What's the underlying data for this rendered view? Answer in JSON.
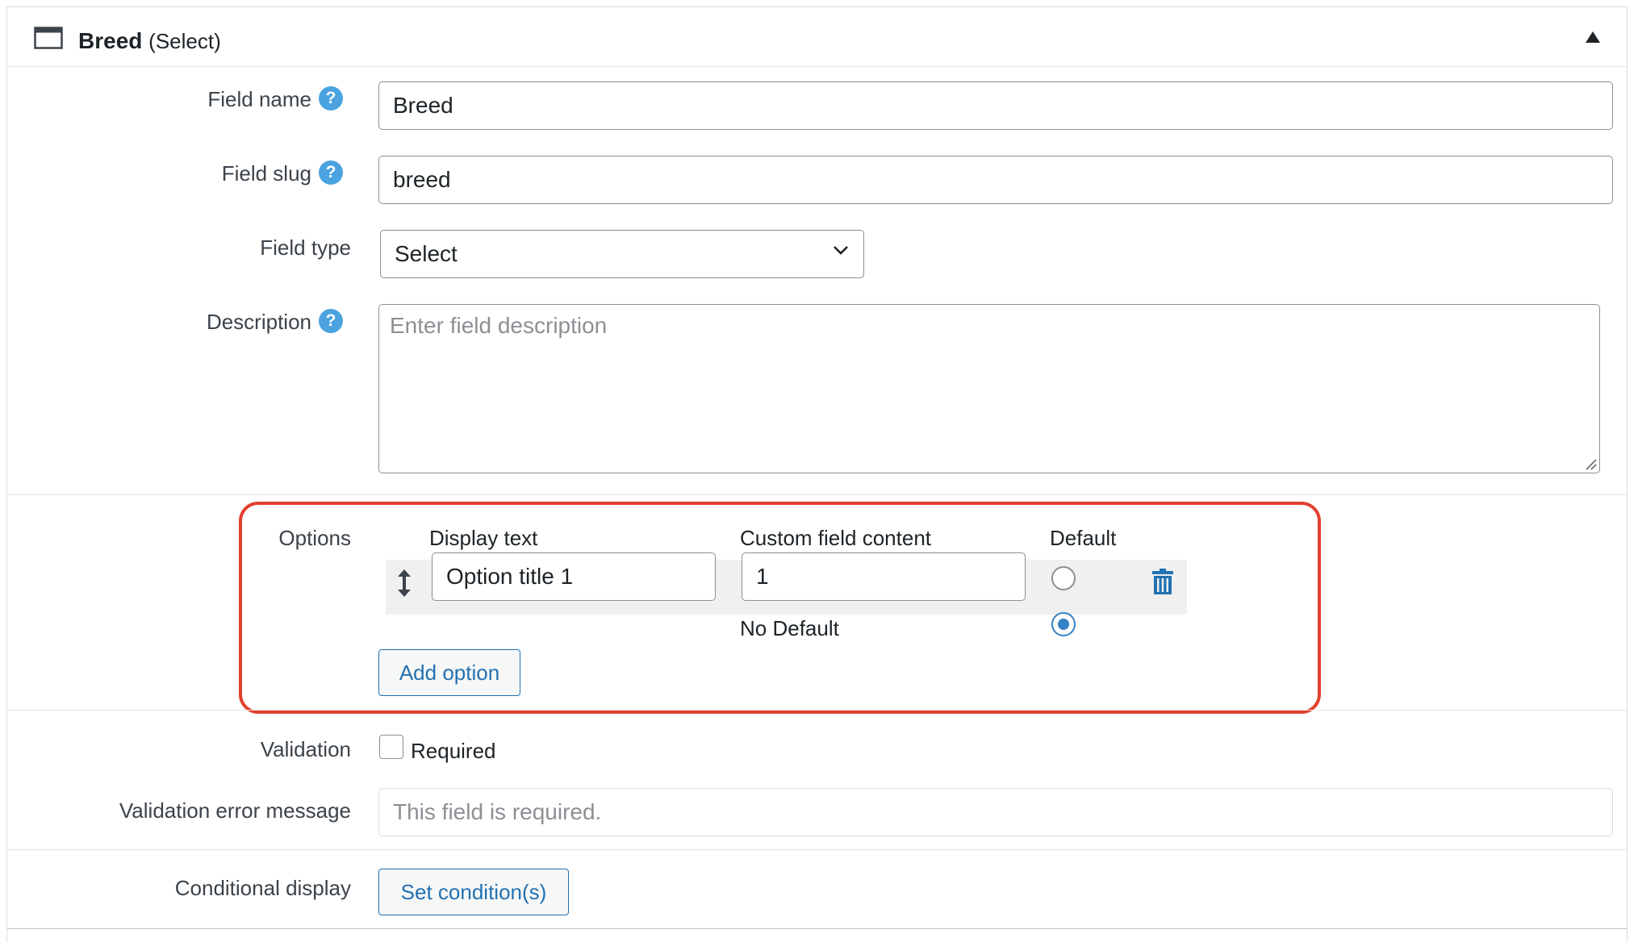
{
  "header": {
    "field_label": "Breed",
    "field_type": "(Select)"
  },
  "field_name": {
    "label": "Field name",
    "help": "?",
    "value": "Breed"
  },
  "field_slug": {
    "label": "Field slug",
    "help": "?",
    "value": "breed"
  },
  "field_type": {
    "label": "Field type",
    "selected": "Select"
  },
  "description": {
    "label": "Description",
    "help": "?",
    "placeholder": "Enter field description"
  },
  "options": {
    "label": "Options",
    "columns": {
      "display_text": "Display text",
      "custom_field_content": "Custom field content",
      "default": "Default"
    },
    "items": [
      {
        "display_text": "Option title 1",
        "custom_field_content": "1",
        "is_default": false
      }
    ],
    "no_default_label": "No Default",
    "no_default_selected": true,
    "add_option_label": "Add option"
  },
  "validation": {
    "label": "Validation",
    "required_label": "Required",
    "required_checked": false
  },
  "validation_error": {
    "label": "Validation error message",
    "placeholder": "This field is required."
  },
  "conditional_display": {
    "label": "Conditional display",
    "button_label": "Set condition(s)"
  },
  "colors": {
    "accent": "#2271b1",
    "help_icon": "#4aa3df",
    "highlight_border": "#e2402f"
  }
}
